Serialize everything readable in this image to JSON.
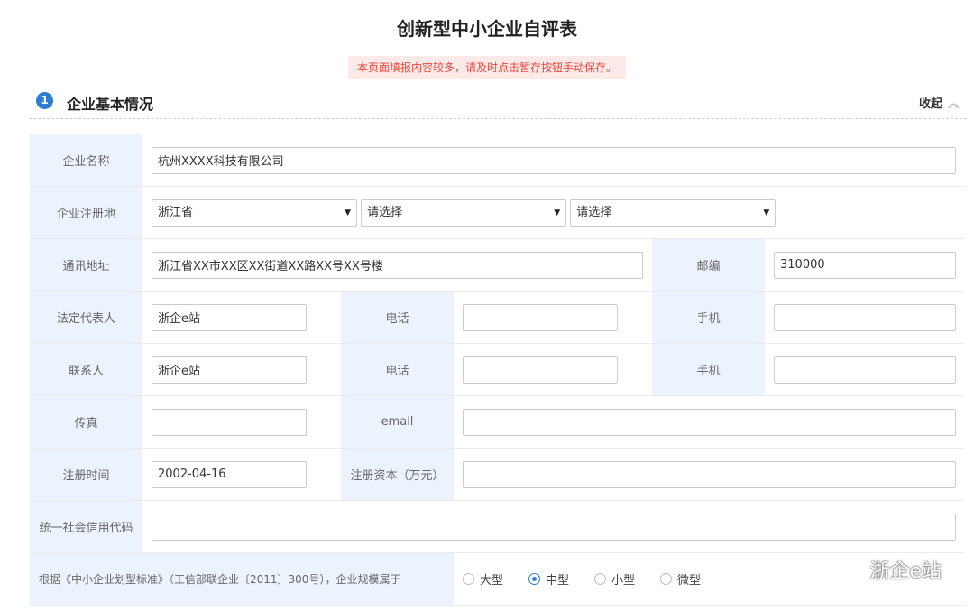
{
  "page": {
    "title": "创新型中小企业自评表"
  },
  "notice": "本页面填报内容较多，请及时点击暂存按钮手动保存。",
  "section": {
    "number": "1",
    "title": "企业基本情况",
    "collapse_label": "收起"
  },
  "form": {
    "company_name": {
      "label": "企业名称",
      "value": "杭州XXXX科技有限公司"
    },
    "reg_place": {
      "label": "企业注册地",
      "province": "浙江省",
      "city": "请选择",
      "district": "请选择"
    },
    "address": {
      "label": "通讯地址",
      "value": "浙江省XX市XX区XX街道XX路XX号XX号楼"
    },
    "postcode": {
      "label": "邮编",
      "value": "310000"
    },
    "legal_rep": {
      "label": "法定代表人",
      "value": "浙企e站"
    },
    "legal_phone": {
      "label": "电话",
      "value": ""
    },
    "legal_mobile": {
      "label": "手机",
      "value": ""
    },
    "contact": {
      "label": "联系人",
      "value": "浙企e站"
    },
    "contact_phone": {
      "label": "电话",
      "value": ""
    },
    "contact_mobile": {
      "label": "手机",
      "value": ""
    },
    "fax": {
      "label": "传真",
      "value": ""
    },
    "email": {
      "label": "email",
      "value": ""
    },
    "reg_date": {
      "label": "注册时间",
      "value": "2002-04-16"
    },
    "reg_capital": {
      "label": "注册资本（万元）",
      "value": ""
    },
    "credit_code": {
      "label": "统一社会信用代码",
      "value": ""
    },
    "scale": {
      "label": "根据《中小企业划型标准》（工信部联企业〔2011〕300号），企业规模属于",
      "options": [
        "大型",
        "中型",
        "小型",
        "微型"
      ],
      "selected": "中型"
    }
  },
  "watermark": "浙企e站",
  "colors": {
    "accent": "#2d7dd2",
    "label_bg": "#ecf3fc",
    "notice_bg": "#fde9e7",
    "notice_text": "#e8483b"
  }
}
